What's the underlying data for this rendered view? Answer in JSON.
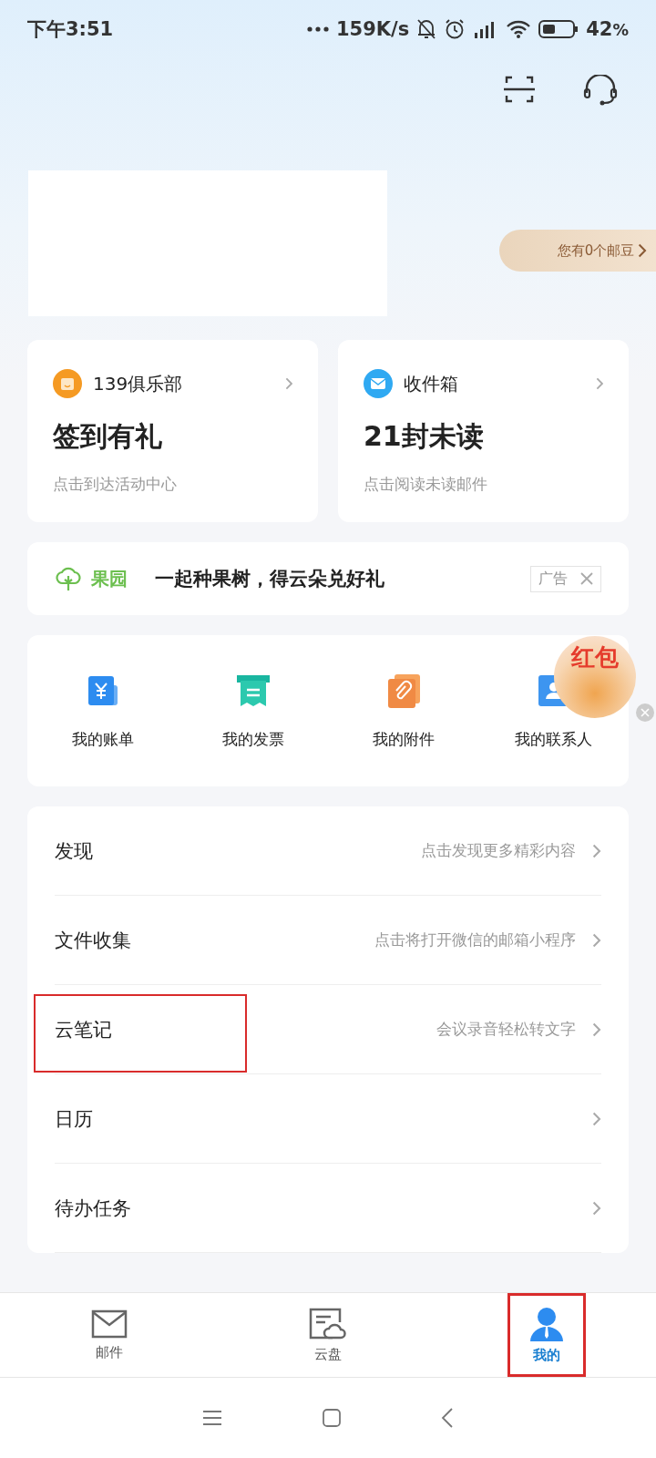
{
  "status_bar": {
    "time": "下午3:51",
    "speed": "159K/s",
    "battery": "42",
    "battery_unit": "%"
  },
  "points_pill": {
    "label": "您有0个邮豆"
  },
  "cards": [
    {
      "kind": "club",
      "title": "139俱乐部",
      "headline": "签到有礼",
      "subtitle": "点击到达活动中心"
    },
    {
      "kind": "inbox",
      "title": "收件箱",
      "headline": "21封未读",
      "subtitle": "点击阅读未读邮件"
    }
  ],
  "banner": {
    "brand": "果园",
    "text": "一起种果树，得云朵兑好礼",
    "ad_label": "广告"
  },
  "shortcuts": [
    {
      "kind": "bill",
      "label": "我的账单"
    },
    {
      "kind": "invoice",
      "label": "我的发票"
    },
    {
      "kind": "attachment",
      "label": "我的附件"
    },
    {
      "kind": "contacts",
      "label": "我的联系人"
    }
  ],
  "red_packet": {
    "label": "红包"
  },
  "menu": [
    {
      "title": "发现",
      "hint": "点击发现更多精彩内容",
      "highlighted": false
    },
    {
      "title": "文件收集",
      "hint": "点击将打开微信的邮箱小程序",
      "highlighted": false
    },
    {
      "title": "云笔记",
      "hint": "会议录音轻松转文字",
      "highlighted": true
    },
    {
      "title": "日历",
      "highlighted": false
    },
    {
      "title": "待办任务",
      "highlighted": false
    }
  ],
  "tabs": [
    {
      "kind": "mail",
      "label": "邮件",
      "selected": false,
      "highlighted": false
    },
    {
      "kind": "cloud",
      "label": "云盘",
      "selected": false,
      "highlighted": false
    },
    {
      "kind": "me",
      "label": "我的",
      "selected": true,
      "highlighted": true
    }
  ]
}
